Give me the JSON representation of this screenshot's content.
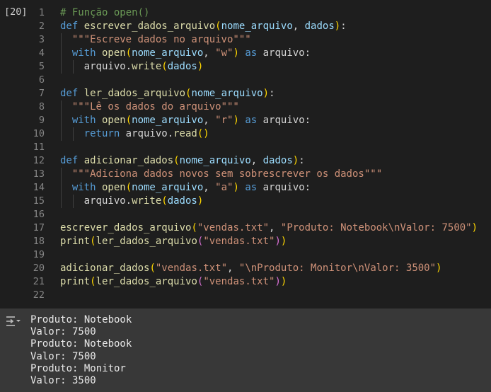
{
  "cell": {
    "execution_count": "[20]",
    "lines": [
      {
        "n": "1",
        "tokens": [
          {
            "t": "# Função open()",
            "c": "c"
          }
        ]
      },
      {
        "n": "2",
        "tokens": [
          {
            "t": "def",
            "c": "k"
          },
          {
            "t": " ",
            "c": "w"
          },
          {
            "t": "escrever_dados_arquivo",
            "c": "f"
          },
          {
            "t": "(",
            "c": "b1"
          },
          {
            "t": "nome_arquivo",
            "c": "p"
          },
          {
            "t": ", ",
            "c": "w"
          },
          {
            "t": "dados",
            "c": "p"
          },
          {
            "t": ")",
            "c": "b1"
          },
          {
            "t": ":",
            "c": "w"
          }
        ]
      },
      {
        "n": "3",
        "indent": 1,
        "tokens": [
          {
            "t": "\"\"\"Escreve dados no arquivo\"\"\"",
            "c": "s"
          }
        ]
      },
      {
        "n": "4",
        "indent": 1,
        "tokens": [
          {
            "t": "with",
            "c": "k"
          },
          {
            "t": " ",
            "c": "w"
          },
          {
            "t": "open",
            "c": "f"
          },
          {
            "t": "(",
            "c": "b1"
          },
          {
            "t": "nome_arquivo",
            "c": "p"
          },
          {
            "t": ", ",
            "c": "w"
          },
          {
            "t": "\"w\"",
            "c": "s"
          },
          {
            "t": ")",
            "c": "b1"
          },
          {
            "t": " ",
            "c": "w"
          },
          {
            "t": "as",
            "c": "k"
          },
          {
            "t": " arquivo:",
            "c": "w"
          }
        ]
      },
      {
        "n": "5",
        "indent": 2,
        "tokens": [
          {
            "t": "arquivo.",
            "c": "w"
          },
          {
            "t": "write",
            "c": "f"
          },
          {
            "t": "(",
            "c": "b1"
          },
          {
            "t": "dados",
            "c": "p"
          },
          {
            "t": ")",
            "c": "b1"
          }
        ]
      },
      {
        "n": "6",
        "tokens": []
      },
      {
        "n": "7",
        "tokens": [
          {
            "t": "def",
            "c": "k"
          },
          {
            "t": " ",
            "c": "w"
          },
          {
            "t": "ler_dados_arquivo",
            "c": "f"
          },
          {
            "t": "(",
            "c": "b1"
          },
          {
            "t": "nome_arquivo",
            "c": "p"
          },
          {
            "t": ")",
            "c": "b1"
          },
          {
            "t": ":",
            "c": "w"
          }
        ]
      },
      {
        "n": "8",
        "indent": 1,
        "tokens": [
          {
            "t": "\"\"\"Lê os dados do arquivo\"\"\"",
            "c": "s"
          }
        ]
      },
      {
        "n": "9",
        "indent": 1,
        "tokens": [
          {
            "t": "with",
            "c": "k"
          },
          {
            "t": " ",
            "c": "w"
          },
          {
            "t": "open",
            "c": "f"
          },
          {
            "t": "(",
            "c": "b1"
          },
          {
            "t": "nome_arquivo",
            "c": "p"
          },
          {
            "t": ", ",
            "c": "w"
          },
          {
            "t": "\"r\"",
            "c": "s"
          },
          {
            "t": ")",
            "c": "b1"
          },
          {
            "t": " ",
            "c": "w"
          },
          {
            "t": "as",
            "c": "k"
          },
          {
            "t": " arquivo:",
            "c": "w"
          }
        ]
      },
      {
        "n": "10",
        "indent": 2,
        "tokens": [
          {
            "t": "return",
            "c": "k"
          },
          {
            "t": " arquivo.",
            "c": "w"
          },
          {
            "t": "read",
            "c": "f"
          },
          {
            "t": "()",
            "c": "b1"
          }
        ]
      },
      {
        "n": "11",
        "tokens": []
      },
      {
        "n": "12",
        "tokens": [
          {
            "t": "def",
            "c": "k"
          },
          {
            "t": " ",
            "c": "w"
          },
          {
            "t": "adicionar_dados",
            "c": "f"
          },
          {
            "t": "(",
            "c": "b1"
          },
          {
            "t": "nome_arquivo",
            "c": "p"
          },
          {
            "t": ", ",
            "c": "w"
          },
          {
            "t": "dados",
            "c": "p"
          },
          {
            "t": ")",
            "c": "b1"
          },
          {
            "t": ":",
            "c": "w"
          }
        ]
      },
      {
        "n": "13",
        "indent": 1,
        "tokens": [
          {
            "t": "\"\"\"Adiciona dados novos sem sobrescrever os dados\"\"\"",
            "c": "s"
          }
        ]
      },
      {
        "n": "14",
        "indent": 1,
        "tokens": [
          {
            "t": "with",
            "c": "k"
          },
          {
            "t": " ",
            "c": "w"
          },
          {
            "t": "open",
            "c": "f"
          },
          {
            "t": "(",
            "c": "b1"
          },
          {
            "t": "nome_arquivo",
            "c": "p"
          },
          {
            "t": ", ",
            "c": "w"
          },
          {
            "t": "\"a\"",
            "c": "s"
          },
          {
            "t": ")",
            "c": "b1"
          },
          {
            "t": " ",
            "c": "w"
          },
          {
            "t": "as",
            "c": "k"
          },
          {
            "t": " arquivo:",
            "c": "w"
          }
        ]
      },
      {
        "n": "15",
        "indent": 2,
        "tokens": [
          {
            "t": "arquivo.",
            "c": "w"
          },
          {
            "t": "write",
            "c": "f"
          },
          {
            "t": "(",
            "c": "b1"
          },
          {
            "t": "dados",
            "c": "p"
          },
          {
            "t": ")",
            "c": "b1"
          }
        ]
      },
      {
        "n": "16",
        "tokens": []
      },
      {
        "n": "17",
        "tokens": [
          {
            "t": "escrever_dados_arquivo",
            "c": "f"
          },
          {
            "t": "(",
            "c": "b1"
          },
          {
            "t": "\"vendas.txt\"",
            "c": "s"
          },
          {
            "t": ", ",
            "c": "w"
          },
          {
            "t": "\"Produto: Notebook\\nValor: 7500\"",
            "c": "s"
          },
          {
            "t": ")",
            "c": "b1"
          }
        ]
      },
      {
        "n": "18",
        "tokens": [
          {
            "t": "print",
            "c": "f"
          },
          {
            "t": "(",
            "c": "b1"
          },
          {
            "t": "ler_dados_arquivo",
            "c": "f"
          },
          {
            "t": "(",
            "c": "b2"
          },
          {
            "t": "\"vendas.txt\"",
            "c": "s"
          },
          {
            "t": ")",
            "c": "b2"
          },
          {
            "t": ")",
            "c": "b1"
          }
        ]
      },
      {
        "n": "19",
        "tokens": []
      },
      {
        "n": "20",
        "tokens": [
          {
            "t": "adicionar_dados",
            "c": "f"
          },
          {
            "t": "(",
            "c": "b1"
          },
          {
            "t": "\"vendas.txt\"",
            "c": "s"
          },
          {
            "t": ", ",
            "c": "w"
          },
          {
            "t": "\"\\nProduto: Monitor\\nValor: 3500\"",
            "c": "s"
          },
          {
            "t": ")",
            "c": "b1"
          }
        ]
      },
      {
        "n": "21",
        "tokens": [
          {
            "t": "print",
            "c": "f"
          },
          {
            "t": "(",
            "c": "b1"
          },
          {
            "t": "ler_dados_arquivo",
            "c": "f"
          },
          {
            "t": "(",
            "c": "b2"
          },
          {
            "t": "\"vendas.txt\"",
            "c": "s"
          },
          {
            "t": ")",
            "c": "b2"
          },
          {
            "t": ")",
            "c": "b1"
          }
        ]
      },
      {
        "n": "22",
        "tokens": []
      }
    ]
  },
  "output": {
    "icon": "output-toggle-icon",
    "lines": [
      "Produto: Notebook",
      "Valor: 7500",
      "Produto: Notebook",
      "Valor: 7500",
      "Produto: Monitor",
      "Valor: 3500"
    ]
  },
  "colors": {
    "background": "#1e1e1e",
    "output_background": "#383838",
    "keyword": "#569cd6",
    "comment": "#6a9955",
    "string": "#ce9178",
    "function": "#dcdcaa",
    "parameter": "#9cdcfe",
    "bracket_level1": "#ffd700",
    "bracket_level2": "#da70d6"
  }
}
